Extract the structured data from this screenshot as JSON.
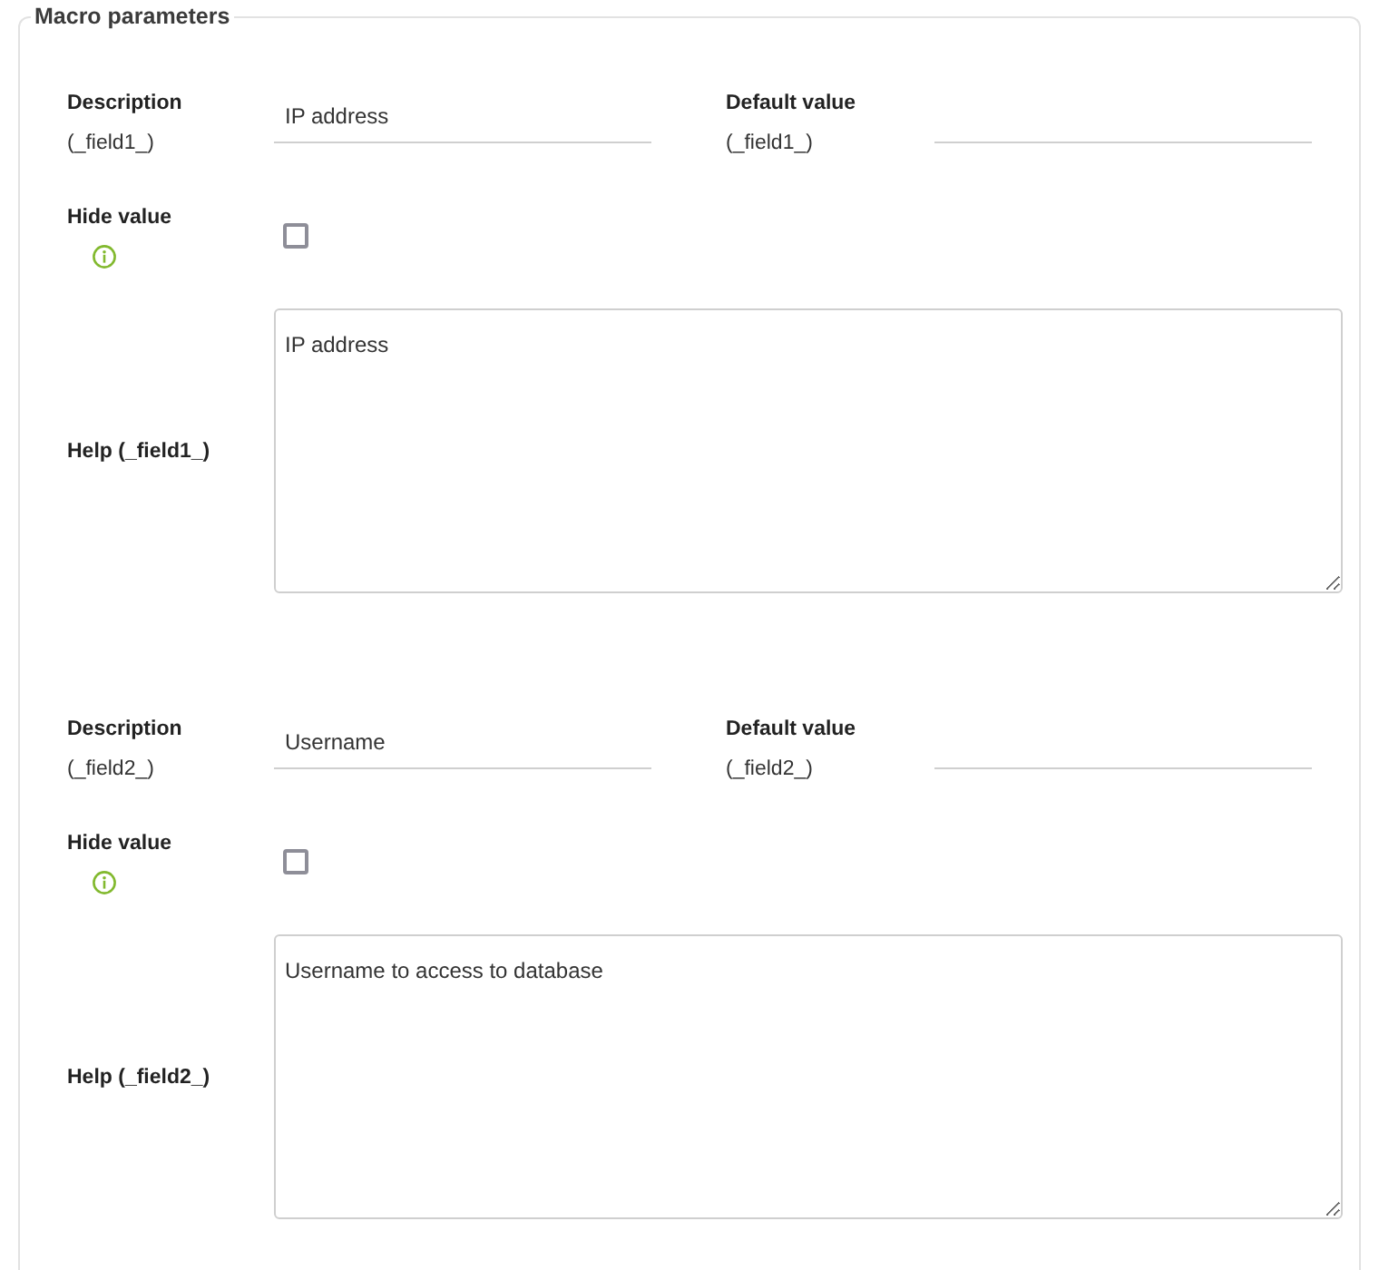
{
  "panel": {
    "legend": "Macro parameters"
  },
  "fields": [
    {
      "description_label": "Description",
      "description_key": "(_field1_)",
      "description_value": "IP address",
      "default_label": "Default value",
      "default_key": "(_field1_)",
      "hide_label": "Hide value",
      "hide_checked": false,
      "help_label": "Help (_field1_)",
      "help_text": "IP address"
    },
    {
      "description_label": "Description",
      "description_key": "(_field2_)",
      "description_value": "Username",
      "default_label": "Default value",
      "default_key": "(_field2_)",
      "hide_label": "Hide value",
      "hide_checked": false,
      "help_label": "Help (_field2_)",
      "help_text": "Username to access to database"
    }
  ]
}
